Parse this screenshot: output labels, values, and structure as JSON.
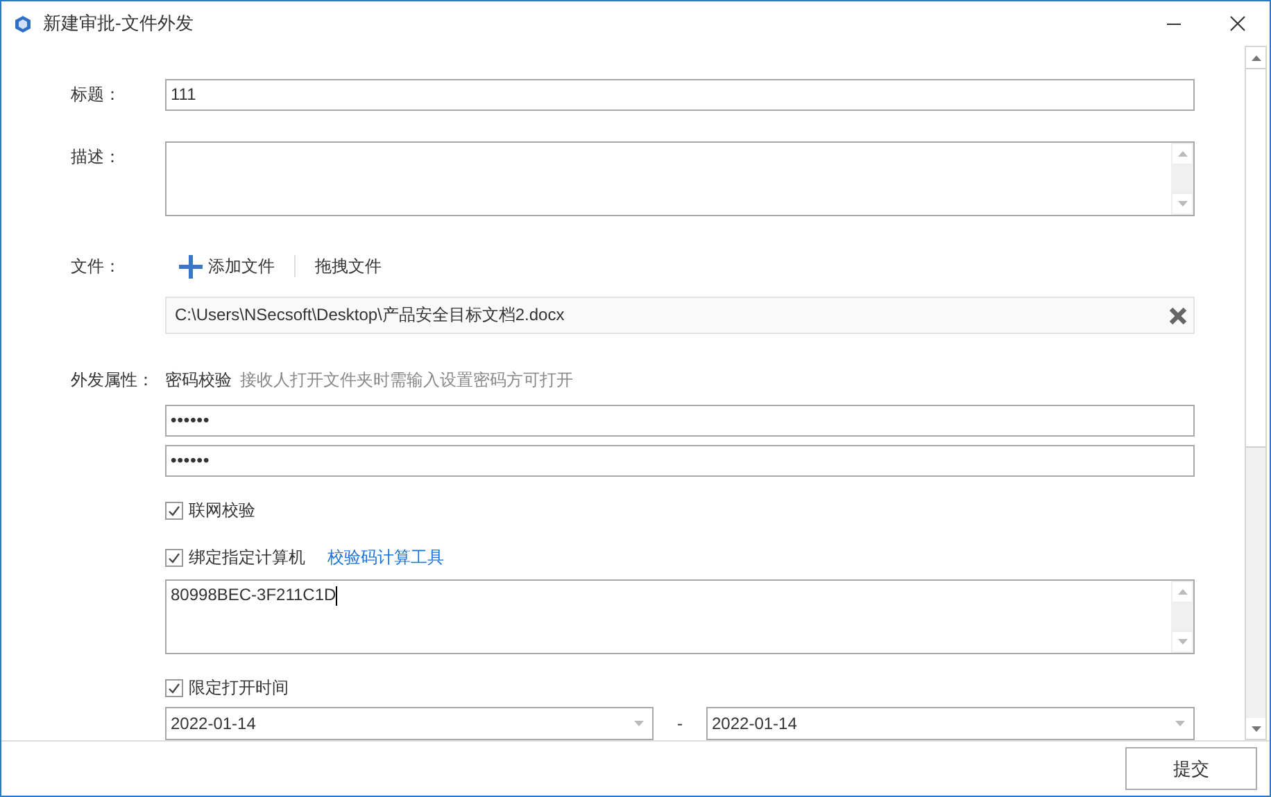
{
  "window": {
    "title": "新建审批-文件外发"
  },
  "title_field": {
    "label": "标题：",
    "value": "111"
  },
  "description_field": {
    "label": "描述："
  },
  "files": {
    "label": "文件：",
    "add_button": "添加文件",
    "drag_button": "拖拽文件",
    "items": [
      {
        "path": "C:\\Users\\NSecsoft\\Desktop\\产品安全目标文档2.docx"
      }
    ]
  },
  "properties": {
    "label": "外发属性：",
    "password_title": "密码校验",
    "password_hint": "接收人打开文件夹时需输入设置密码方可打开",
    "passwords": [
      "••••••",
      "••••••"
    ],
    "online_check": {
      "label": "联网校验",
      "checked": true
    },
    "bind_computer": {
      "label": "绑定指定计算机",
      "checked": true,
      "link": "校验码计算工具",
      "codes": "80998BEC-3F211C1D"
    },
    "time_limit": {
      "label": "限定打开时间",
      "checked": true,
      "start": "2022-01-14",
      "separator": "-",
      "end": "2022-01-14"
    }
  },
  "buttons": [
    "提交"
  ]
}
